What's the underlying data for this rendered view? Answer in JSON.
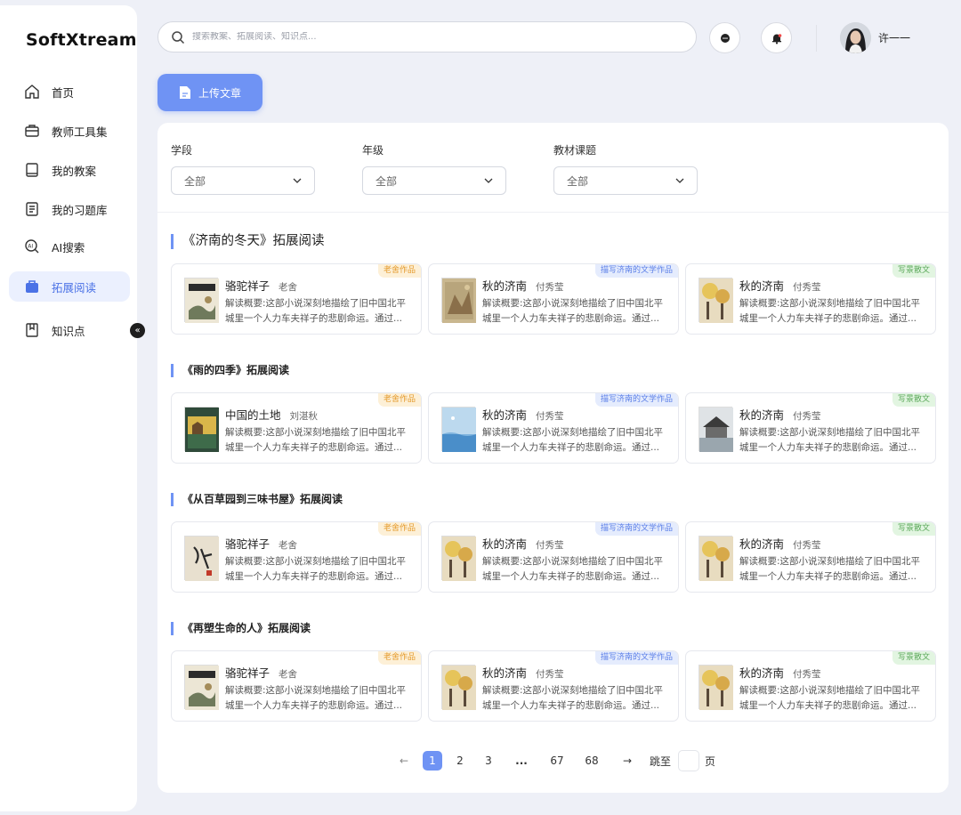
{
  "app": {
    "brand": "SoftXtream"
  },
  "sidebar": {
    "items": [
      {
        "label": "首页",
        "icon": "home-icon"
      },
      {
        "label": "教师工具集",
        "icon": "toolbox-icon"
      },
      {
        "label": "我的教案",
        "icon": "book-icon"
      },
      {
        "label": "我的习题库",
        "icon": "document-list-icon"
      },
      {
        "label": "AI搜索",
        "icon": "ai-search-icon"
      },
      {
        "label": "拓展阅读",
        "icon": "briefcase-icon",
        "active": true
      },
      {
        "label": "知识点",
        "icon": "bookmark-icon"
      }
    ],
    "collapse_glyph": "«"
  },
  "header": {
    "search_placeholder": "搜索教案、拓展阅读、知识点...",
    "user_name": "许一一"
  },
  "toolbar": {
    "upload_label": "上传文章"
  },
  "filters": [
    {
      "label": "学段",
      "value": "全部"
    },
    {
      "label": "年级",
      "value": "全部"
    },
    {
      "label": "教材课题",
      "value": "全部"
    }
  ],
  "sections": [
    {
      "title": "《济南的冬天》拓展阅读",
      "cards": [
        {
          "title": "骆驼祥子",
          "author": "老舍",
          "desc": "解读概要:这部小说深刻地描绘了旧中国北平城里一个人力车夫祥子的悲剧命运。通过...",
          "tag": "老舍作品",
          "tag_color": "orange"
        },
        {
          "title": "秋的济南",
          "author": "付秀莹",
          "desc": "解读概要:这部小说深刻地描绘了旧中国北平城里一个人力车夫祥子的悲剧命运。通过...",
          "tag": "描写济南的文学作品",
          "tag_color": "blue"
        },
        {
          "title": "秋的济南",
          "author": "付秀莹",
          "desc": "解读概要:这部小说深刻地描绘了旧中国北平城里一个人力车夫祥子的悲剧命运。通过...",
          "tag": "写景散文",
          "tag_color": "green"
        }
      ]
    },
    {
      "title": "《雨的四季》拓展阅读",
      "cards": [
        {
          "title": "中国的土地",
          "author": "刘湛秋",
          "desc": "解读概要:这部小说深刻地描绘了旧中国北平城里一个人力车夫祥子的悲剧命运。通过...",
          "tag": "老舍作品",
          "tag_color": "orange"
        },
        {
          "title": "秋的济南",
          "author": "付秀莹",
          "desc": "解读概要:这部小说深刻地描绘了旧中国北平城里一个人力车夫祥子的悲剧命运。通过...",
          "tag": "描写济南的文学作品",
          "tag_color": "blue"
        },
        {
          "title": "秋的济南",
          "author": "付秀莹",
          "desc": "解读概要:这部小说深刻地描绘了旧中国北平城里一个人力车夫祥子的悲剧命运。通过...",
          "tag": "写景散文",
          "tag_color": "green"
        }
      ]
    },
    {
      "title": "《从百草园到三味书屋》拓展阅读",
      "cards": [
        {
          "title": "骆驼祥子",
          "author": "老舍",
          "desc": "解读概要:这部小说深刻地描绘了旧中国北平城里一个人力车夫祥子的悲剧命运。通过...",
          "tag": "老舍作品",
          "tag_color": "orange"
        },
        {
          "title": "秋的济南",
          "author": "付秀莹",
          "desc": "解读概要:这部小说深刻地描绘了旧中国北平城里一个人力车夫祥子的悲剧命运。通过...",
          "tag": "描写济南的文学作品",
          "tag_color": "blue"
        },
        {
          "title": "秋的济南",
          "author": "付秀莹",
          "desc": "解读概要:这部小说深刻地描绘了旧中国北平城里一个人力车夫祥子的悲剧命运。通过...",
          "tag": "写景散文",
          "tag_color": "green"
        }
      ]
    },
    {
      "title": "《再塑生命的人》拓展阅读",
      "cards": [
        {
          "title": "骆驼祥子",
          "author": "老舍",
          "desc": "解读概要:这部小说深刻地描绘了旧中国北平城里一个人力车夫祥子的悲剧命运。通过...",
          "tag": "老舍作品",
          "tag_color": "orange"
        },
        {
          "title": "秋的济南",
          "author": "付秀莹",
          "desc": "解读概要:这部小说深刻地描绘了旧中国北平城里一个人力车夫祥子的悲剧命运。通过...",
          "tag": "描写济南的文学作品",
          "tag_color": "blue"
        },
        {
          "title": "秋的济南",
          "author": "付秀莹",
          "desc": "解读概要:这部小说深刻地描绘了旧中国北平城里一个人力车夫祥子的悲剧命运。通过...",
          "tag": "写景散文",
          "tag_color": "green"
        }
      ]
    }
  ],
  "pagination": {
    "prev": "←",
    "pages": [
      "1",
      "2",
      "3",
      "...",
      "67",
      "68"
    ],
    "current": "1",
    "next": "→",
    "jump_label": "跳至",
    "page_suffix": "页"
  },
  "colors": {
    "accent": "#6f93f4",
    "active_bg": "#ebf0fe",
    "tag_orange": "#e49a2c",
    "tag_blue": "#5b7fe8",
    "tag_green": "#5aa859"
  }
}
